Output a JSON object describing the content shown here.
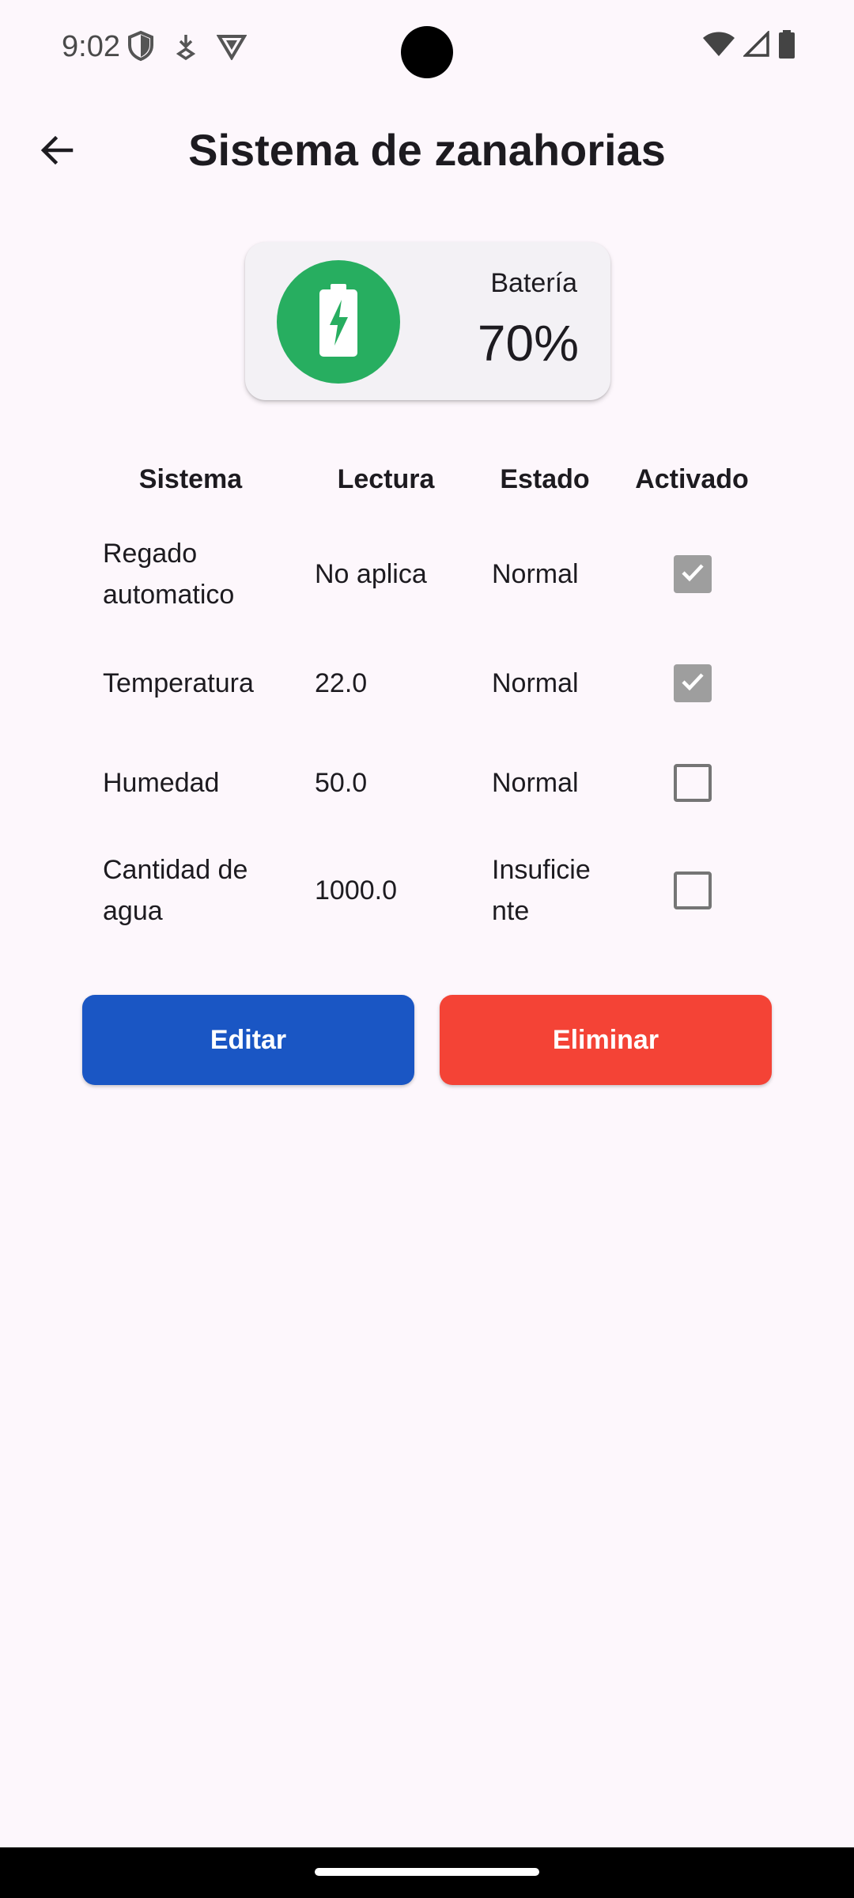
{
  "status_bar": {
    "time": "9:02",
    "left_icons": [
      "shield-icon",
      "download-notification-icon",
      "vpn-icon"
    ],
    "right_icons": [
      "wifi-icon",
      "cellular-signal-icon",
      "battery-status-icon"
    ]
  },
  "app_bar": {
    "back_icon": "arrow-back-icon",
    "title": "Sistema de zanahorias"
  },
  "battery": {
    "icon": "battery-charging-icon",
    "label": "Batería",
    "value": "70%",
    "color": "#27AE60"
  },
  "table": {
    "headers": {
      "sistema": "Sistema",
      "lectura": "Lectura",
      "estado": "Estado",
      "activado": "Activado"
    },
    "rows": [
      {
        "sistema": "Regado automatico",
        "lectura": "No aplica",
        "estado": "Normal",
        "activado": true
      },
      {
        "sistema": "Temperatura",
        "lectura": "22.0",
        "estado": "Normal",
        "activado": true
      },
      {
        "sistema": "Humedad",
        "lectura": "50.0",
        "estado": "Normal",
        "activado": false
      },
      {
        "sistema": "Cantidad de agua",
        "lectura": "1000.0",
        "estado": "Insuficiente",
        "activado": false
      }
    ]
  },
  "actions": {
    "edit_label": "Editar",
    "delete_label": "Eliminar",
    "edit_color": "#1A56C4",
    "delete_color": "#F44336"
  }
}
